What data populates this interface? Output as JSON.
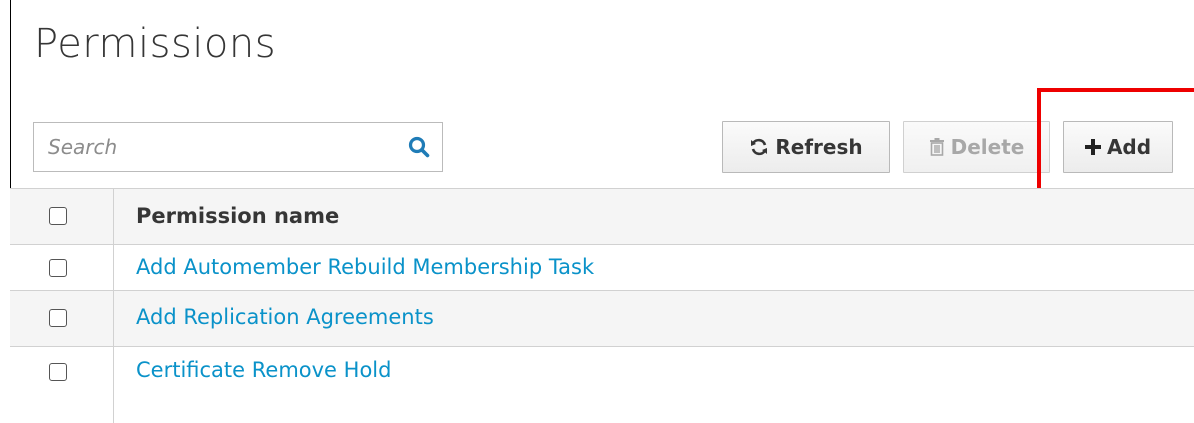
{
  "page": {
    "title": "Permissions"
  },
  "search": {
    "placeholder": "Search",
    "value": "",
    "icon": "search-icon"
  },
  "toolbar": {
    "refresh_label": "Refresh",
    "refresh_icon": "refresh-icon",
    "delete_label": "Delete",
    "delete_icon": "trash-icon",
    "delete_disabled": true,
    "add_label": "Add",
    "add_icon": "plus-icon"
  },
  "highlight": {
    "target": "add-button",
    "color": "#ee0000"
  },
  "table": {
    "columns": [
      "Permission name"
    ],
    "rows": [
      {
        "name": "Add Automember Rebuild Membership Task",
        "checked": false
      },
      {
        "name": "Add Replication Agreements",
        "checked": false
      },
      {
        "name": "Certificate Remove Hold",
        "checked": false
      }
    ]
  },
  "colors": {
    "link": "#0a92c9",
    "title": "#363636",
    "row_alt": "#f5f5f5",
    "border": "#d1d1d1"
  }
}
